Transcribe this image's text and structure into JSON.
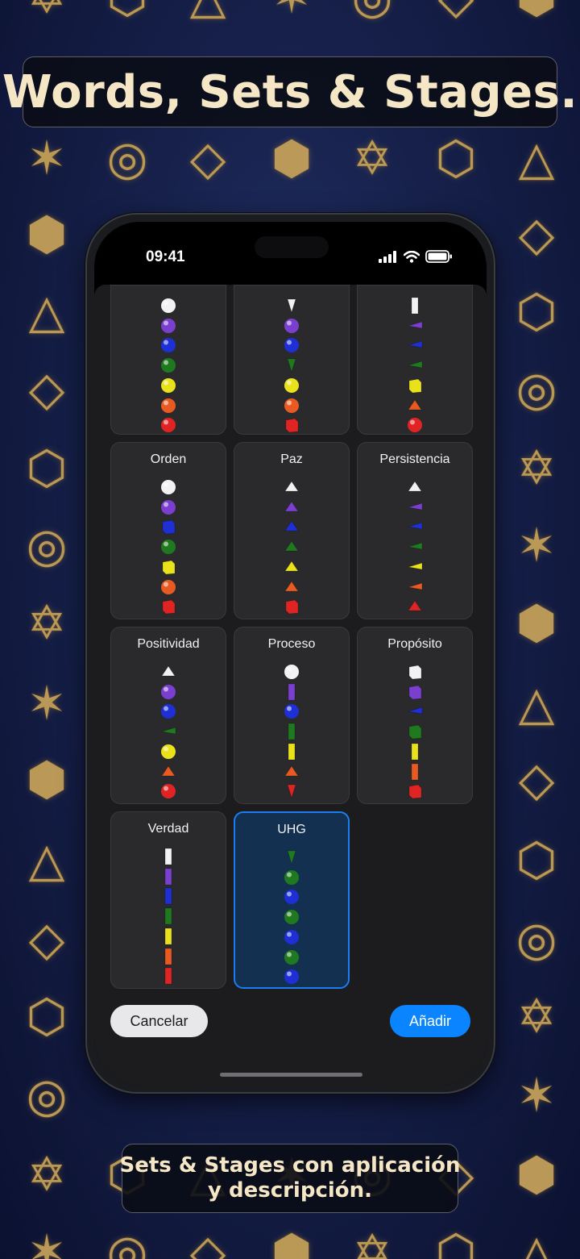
{
  "banner": {
    "title": "Words, Sets & Stages."
  },
  "caption": {
    "line1": "Sets & Stages con aplicación",
    "line2": "y descripción."
  },
  "status_bar": {
    "time": "09:41",
    "icons": [
      "signal-icon",
      "wifi-icon",
      "battery-icon"
    ]
  },
  "background_glyphs": [
    "cube-icon",
    "merkaba-star-icon",
    "tetrahedron-icon",
    "hexagram-icon",
    "spiral-icon",
    "octahedron-icon",
    "icosahedron-icon"
  ],
  "colors": {
    "white": "#f2f2f2",
    "violet": "#7b3fd0",
    "blue": "#1e2fd6",
    "green": "#1f7a1f",
    "yellow": "#e9e21a",
    "orange": "#e85a22",
    "red": "#e02424",
    "accent": "#0a84ff",
    "selected_fill": "#143050"
  },
  "cards": [
    {
      "name": "",
      "selected": false,
      "pieces": [
        {
          "shape": "sphere",
          "color": "white"
        },
        {
          "shape": "sphere",
          "color": "violet"
        },
        {
          "shape": "sphere",
          "color": "blue"
        },
        {
          "shape": "sphere",
          "color": "green"
        },
        {
          "shape": "sphere",
          "color": "yellow"
        },
        {
          "shape": "sphere",
          "color": "orange"
        },
        {
          "shape": "sphere",
          "color": "red"
        }
      ]
    },
    {
      "name": "",
      "selected": false,
      "pieces": [
        {
          "shape": "cone-down",
          "color": "white"
        },
        {
          "shape": "sphere",
          "color": "violet"
        },
        {
          "shape": "sphere",
          "color": "blue"
        },
        {
          "shape": "cone-down",
          "color": "green"
        },
        {
          "shape": "sphere",
          "color": "yellow"
        },
        {
          "shape": "sphere",
          "color": "orange"
        },
        {
          "shape": "cube",
          "color": "red"
        }
      ]
    },
    {
      "name": "",
      "selected": false,
      "pieces": [
        {
          "shape": "bar",
          "color": "white"
        },
        {
          "shape": "cone-side",
          "color": "violet"
        },
        {
          "shape": "cone-side",
          "color": "blue"
        },
        {
          "shape": "cone-side",
          "color": "green"
        },
        {
          "shape": "cube",
          "color": "yellow"
        },
        {
          "shape": "pyramid",
          "color": "orange"
        },
        {
          "shape": "sphere",
          "color": "red"
        }
      ]
    },
    {
      "name": "Orden",
      "selected": false,
      "pieces": [
        {
          "shape": "sphere",
          "color": "white"
        },
        {
          "shape": "sphere",
          "color": "violet"
        },
        {
          "shape": "cube",
          "color": "blue"
        },
        {
          "shape": "sphere",
          "color": "green"
        },
        {
          "shape": "cube",
          "color": "yellow"
        },
        {
          "shape": "sphere",
          "color": "orange"
        },
        {
          "shape": "cube",
          "color": "red"
        }
      ]
    },
    {
      "name": "Paz",
      "selected": false,
      "pieces": [
        {
          "shape": "pyramid",
          "color": "white"
        },
        {
          "shape": "pyramid",
          "color": "violet"
        },
        {
          "shape": "pyramid",
          "color": "blue"
        },
        {
          "shape": "pyramid",
          "color": "green"
        },
        {
          "shape": "pyramid",
          "color": "yellow"
        },
        {
          "shape": "pyramid",
          "color": "orange"
        },
        {
          "shape": "cube",
          "color": "red"
        }
      ]
    },
    {
      "name": "Persistencia",
      "selected": false,
      "pieces": [
        {
          "shape": "pyramid",
          "color": "white"
        },
        {
          "shape": "cone-side",
          "color": "violet"
        },
        {
          "shape": "cone-side",
          "color": "blue"
        },
        {
          "shape": "cone-side",
          "color": "green"
        },
        {
          "shape": "cone-side",
          "color": "yellow"
        },
        {
          "shape": "cone-side",
          "color": "orange"
        },
        {
          "shape": "pyramid",
          "color": "red"
        }
      ]
    },
    {
      "name": "Positividad",
      "selected": false,
      "pieces": [
        {
          "shape": "pyramid",
          "color": "white"
        },
        {
          "shape": "sphere",
          "color": "violet"
        },
        {
          "shape": "sphere",
          "color": "blue"
        },
        {
          "shape": "cone-side",
          "color": "green"
        },
        {
          "shape": "sphere",
          "color": "yellow"
        },
        {
          "shape": "pyramid",
          "color": "orange"
        },
        {
          "shape": "sphere",
          "color": "red"
        }
      ]
    },
    {
      "name": "Proceso",
      "selected": false,
      "pieces": [
        {
          "shape": "sphere",
          "color": "white"
        },
        {
          "shape": "bar",
          "color": "violet"
        },
        {
          "shape": "sphere",
          "color": "blue"
        },
        {
          "shape": "bar",
          "color": "green"
        },
        {
          "shape": "bar",
          "color": "yellow"
        },
        {
          "shape": "pyramid",
          "color": "orange"
        },
        {
          "shape": "cone-down",
          "color": "red"
        }
      ]
    },
    {
      "name": "Propósito",
      "selected": false,
      "pieces": [
        {
          "shape": "cube",
          "color": "white"
        },
        {
          "shape": "cube",
          "color": "violet"
        },
        {
          "shape": "cone-side",
          "color": "blue"
        },
        {
          "shape": "cube",
          "color": "green"
        },
        {
          "shape": "bar",
          "color": "yellow"
        },
        {
          "shape": "bar",
          "color": "orange"
        },
        {
          "shape": "cube",
          "color": "red"
        }
      ]
    },
    {
      "name": "Verdad",
      "selected": false,
      "pieces": [
        {
          "shape": "bar",
          "color": "white"
        },
        {
          "shape": "bar",
          "color": "violet"
        },
        {
          "shape": "bar",
          "color": "blue"
        },
        {
          "shape": "bar",
          "color": "green"
        },
        {
          "shape": "bar",
          "color": "yellow"
        },
        {
          "shape": "bar",
          "color": "orange"
        },
        {
          "shape": "bar",
          "color": "red"
        }
      ]
    },
    {
      "name": "UHG",
      "selected": true,
      "pieces": [
        {
          "shape": "cone-down",
          "color": "green"
        },
        {
          "shape": "sphere",
          "color": "green"
        },
        {
          "shape": "sphere",
          "color": "blue"
        },
        {
          "shape": "sphere",
          "color": "green"
        },
        {
          "shape": "sphere",
          "color": "blue"
        },
        {
          "shape": "sphere",
          "color": "green"
        },
        {
          "shape": "sphere",
          "color": "blue"
        }
      ]
    }
  ],
  "actions": {
    "cancel_label": "Cancelar",
    "add_label": "Añadir"
  }
}
